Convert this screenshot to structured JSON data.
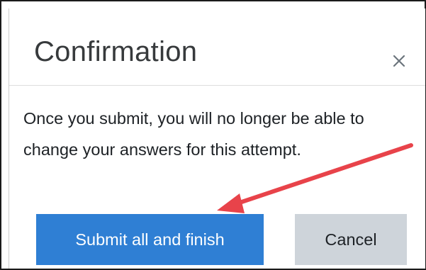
{
  "dialog": {
    "title": "Confirmation",
    "close_label": "Close",
    "message": "Once you submit, you will no longer be able to change your answers for this attempt.",
    "primary_button": "Submit all and finish",
    "secondary_button": "Cancel"
  },
  "colors": {
    "primary": "#2f7fd4",
    "secondary": "#ced4da",
    "annotation_arrow": "#e8434a"
  },
  "icons": {
    "close": "close-icon",
    "annotation": "arrow-annotation-icon"
  }
}
